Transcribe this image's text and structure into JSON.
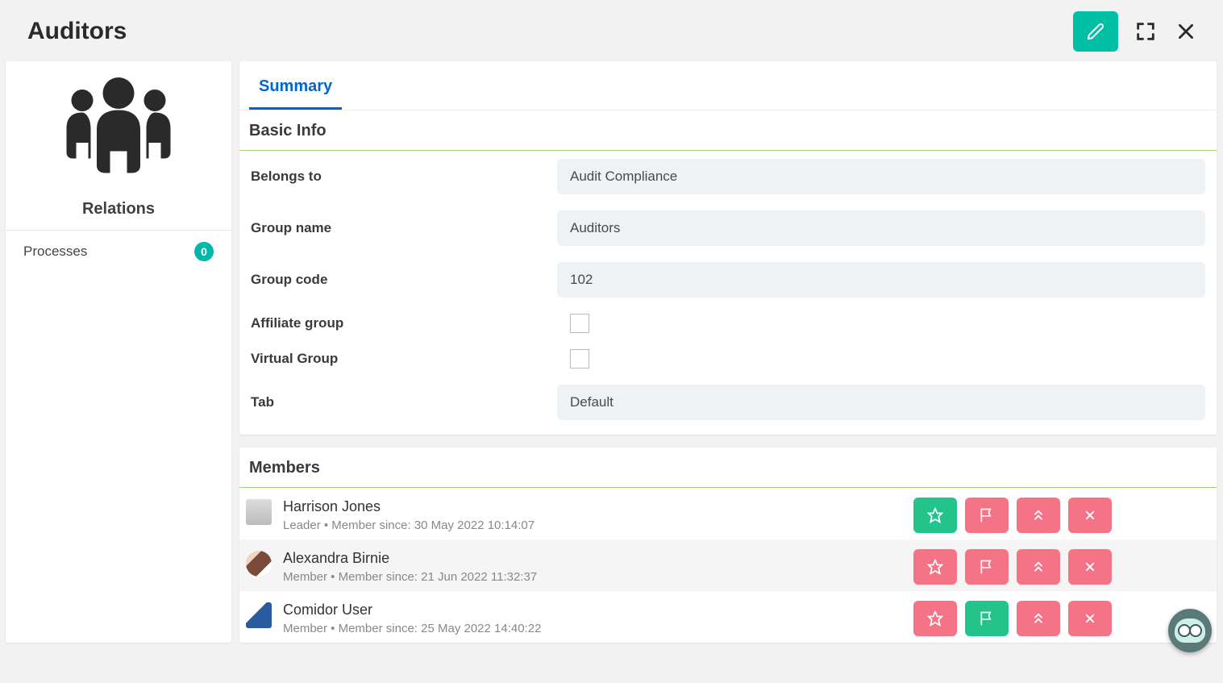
{
  "header": {
    "title": "Auditors"
  },
  "sidebar": {
    "relations_title": "Relations",
    "items": [
      {
        "label": "Processes",
        "count": "0"
      }
    ]
  },
  "tabs": [
    {
      "label": "Summary",
      "active": true
    }
  ],
  "basic_info": {
    "section_title": "Basic Info",
    "fields": {
      "belongs_to_label": "Belongs to",
      "belongs_to_value": "Audit Compliance",
      "group_name_label": "Group name",
      "group_name_value": "Auditors",
      "group_code_label": "Group code",
      "group_code_value": "102",
      "affiliate_group_label": "Affiliate group",
      "virtual_group_label": "Virtual Group",
      "tab_label": "Tab",
      "tab_value": "Default"
    }
  },
  "members": {
    "section_title": "Members",
    "rows": [
      {
        "name": "Harrison Jones",
        "meta": "Leader • Member since: 30 May 2022 10:14:07",
        "star": "green",
        "flag": "pink"
      },
      {
        "name": "Alexandra Birnie",
        "meta": "Member • Member since: 21 Jun 2022 11:32:37",
        "star": "pink",
        "flag": "pink"
      },
      {
        "name": "Comidor User",
        "meta": "Member • Member since: 25 May 2022 14:40:22",
        "star": "pink",
        "flag": "green"
      }
    ]
  }
}
